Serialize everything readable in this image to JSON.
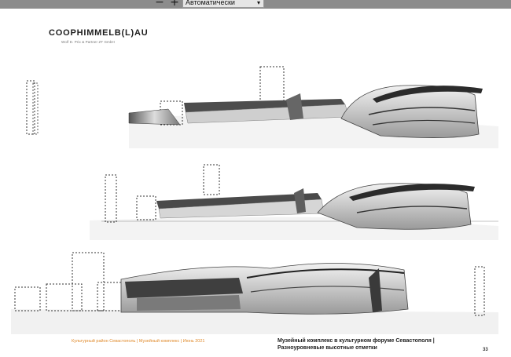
{
  "toolbar": {
    "zoom_out_symbol": "−",
    "zoom_in_symbol": "+",
    "zoom_value": "Автоматически",
    "dropdown_icon": "chevron-down-icon"
  },
  "page": {
    "logo": "COOPHIMMELB(L)AU",
    "logo_subtitle": "Wolf D. Prix & Partner ZT GmbH",
    "footer_left": "Культурный район Севастополь | Музейный комплекс | Июнь 2021",
    "footer_title_line1": "Музейный комплекс в культурном форуме Севастополя |",
    "footer_title_line2": "Разноуровневые высотные отметки",
    "page_number": "33",
    "footer_color": "#e08a2b"
  }
}
